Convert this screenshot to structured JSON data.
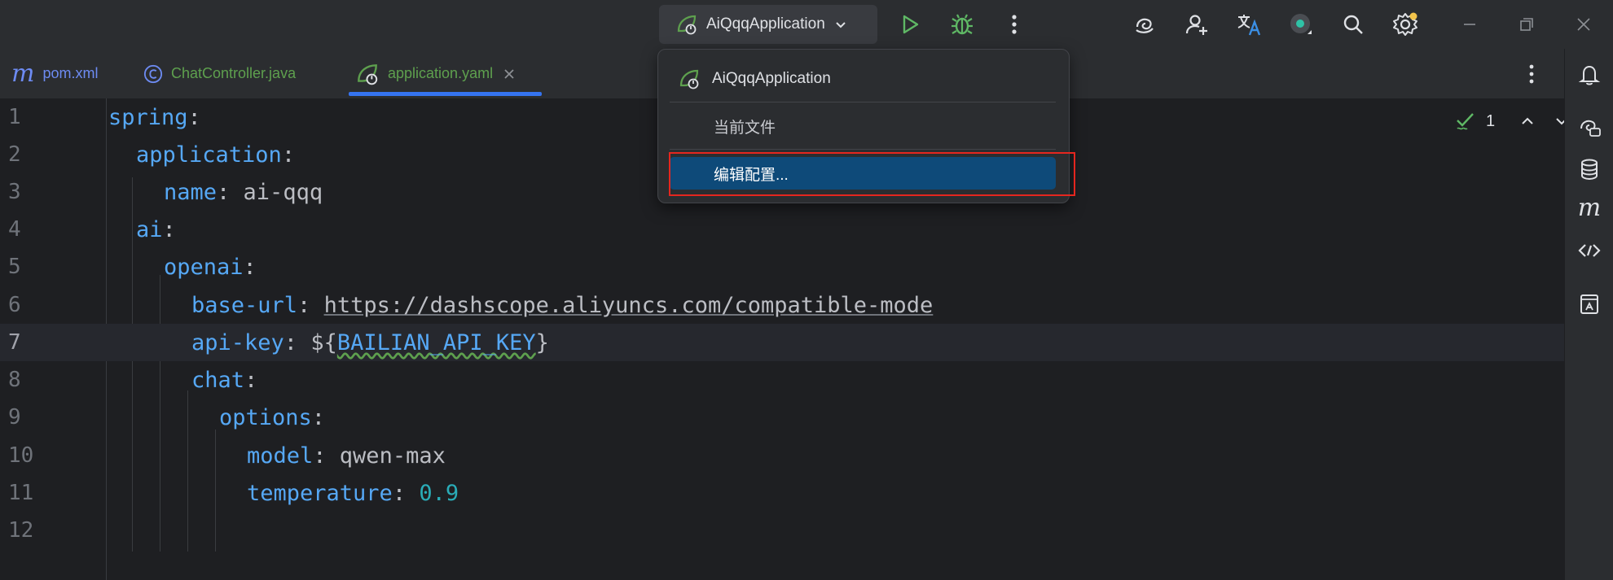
{
  "titlebar": {
    "run_config": "AiQqqApplication",
    "icons": [
      "run-icon",
      "debug-icon",
      "more-icon",
      "ai-assistant-icon",
      "add-user-icon",
      "translate-icon",
      "plugin-status-icon",
      "search-icon",
      "settings-icon",
      "minimize-icon",
      "restore-icon",
      "close-icon"
    ]
  },
  "tabs": [
    {
      "label": "pom.xml",
      "icon": "m",
      "color": "#6d8bf2"
    },
    {
      "label": "ChatController.java",
      "icon": "C",
      "color": "#5ea04e"
    },
    {
      "label": "application.yaml",
      "icon": "spring",
      "color": "#5ea04e",
      "active": true
    }
  ],
  "editor": {
    "line_numbers": [
      "1",
      "2",
      "3",
      "4",
      "5",
      "6",
      "7",
      "8",
      "9",
      "10",
      "11",
      "12"
    ],
    "lines": [
      {
        "key": "spring",
        "sep": ":"
      },
      {
        "key": "application",
        "sep": ":"
      },
      {
        "key": "name",
        "sep": ": ",
        "value": "ai-qqq"
      },
      {
        "key": "ai",
        "sep": ":"
      },
      {
        "key": "openai",
        "sep": ":"
      },
      {
        "key": "base-url",
        "sep": ": ",
        "value": "https://dashscope.aliyuncs.com/compatible-mode"
      },
      {
        "key": "api-key",
        "sep": ": ",
        "prefix": "${",
        "env": "BAILIAN_API_KEY",
        "suffix": "}"
      },
      {
        "key": "chat",
        "sep": ":"
      },
      {
        "key": "options",
        "sep": ":"
      },
      {
        "key": "model",
        "sep": ": ",
        "value": "qwen-max"
      },
      {
        "key": "temperature",
        "sep": ": ",
        "value": "0.9"
      },
      {
        "key": "",
        "sep": ""
      }
    ],
    "inspection_count": "1"
  },
  "dropdown": {
    "items": [
      "AiQqqApplication",
      "当前文件",
      "编辑配置..."
    ],
    "selected_index": 2
  },
  "sidebar_icons": [
    "notifications-icon",
    "ai-chat-icon",
    "database-icon",
    "maven-icon",
    "endpoints-icon",
    "bookmarks-icon"
  ],
  "colors": {
    "accent": "#3574f0",
    "selected": "#0e4a79",
    "highlight": "#e5261f",
    "spring_green": "#5ea04e"
  }
}
